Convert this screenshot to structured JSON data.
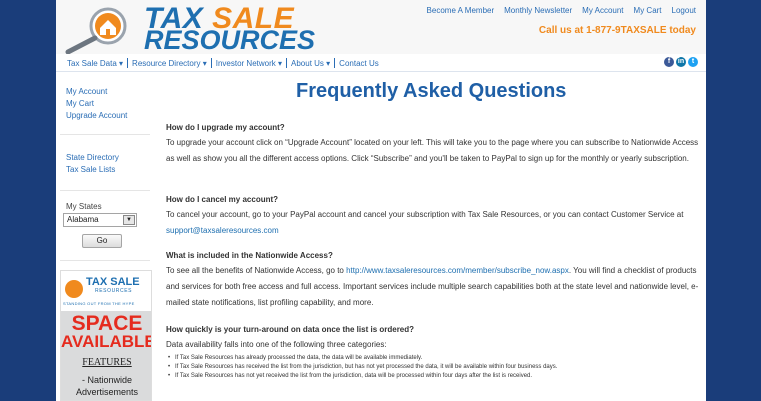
{
  "logo": {
    "word1": "TAX",
    "word2": "SALE",
    "word3": "RESOURCES"
  },
  "topnav": [
    "Become A Member",
    "Monthly Newsletter",
    "My Account",
    "My Cart",
    "Logout"
  ],
  "phone": "Call us at 1-877-9TAXSALE today",
  "mainnav": [
    "Tax Sale Data ▾",
    "Resource Directory ▾",
    "Investor Network ▾",
    "About Us ▾",
    "Contact Us"
  ],
  "social": [
    {
      "icon": "facebook-icon",
      "glyph": "f",
      "color": "#3b5998"
    },
    {
      "icon": "linkedin-icon",
      "glyph": "in",
      "color": "#0e76a8"
    },
    {
      "icon": "twitter-icon",
      "glyph": "t",
      "color": "#1da1f2"
    }
  ],
  "sidebar": {
    "account_links": [
      "My Account",
      "My Cart",
      "Upgrade Account"
    ],
    "directory_links": [
      "State Directory",
      "Tax Sale Lists"
    ],
    "states_label": "My States",
    "states_value": "Alabama",
    "go_label": "Go"
  },
  "ad": {
    "brand": "TAX SALE",
    "brand_sub": "RESOURCES",
    "tagline": "STANDING OUT FROM THE HYPE",
    "space": "SPACE",
    "available": "AVAILABLE",
    "features": "FEATURES",
    "line1": "- Nationwide",
    "line2": "Advertisements"
  },
  "page_title": "Frequently Asked Questions",
  "faqs": [
    {
      "q": "How do I upgrade my account?",
      "a": "To upgrade your account click on “Upgrade Account” located on your left. This will take you to the page where you can subscribe to Nationwide Access as well as show you all the different access options. Click “Subscribe” and you'll be taken to PayPal to sign up for the monthly or yearly subscription."
    },
    {
      "q": "How do I cancel my account?",
      "a_pre": "To cancel your account, go to your PayPal account and cancel your subscription with Tax Sale Resources, or you can contact Customer Service at ",
      "a_link": "support@taxsaleresources.com"
    },
    {
      "q": "What is included in the Nationwide Access?",
      "a_pre": "To see all the benefits of Nationwide Access, go to ",
      "a_link": "http://www.taxsaleresources.com/member/subscribe_now.aspx",
      "a_post": ". You will find a checklist of products and services for both free access and full access. Important services include multiple search capabilities both at the state level and nationwide level, e-mailed state notifications, list profiling capability, and more."
    },
    {
      "q": "How quickly is your turn-around on data once the list is ordered?",
      "a": "Data availability falls into one of the following three categories:",
      "bullets": [
        "If Tax Sale Resources has already processed the data, the data will be available immediately.",
        "If Tax Sale Resources has received the list from the jurisdiction, but has not yet processed the data, it will be available within four business days.",
        "If Tax Sale Resources has not yet received the list from the jurisdiction, data will be processed within four days after the list is received."
      ]
    }
  ]
}
